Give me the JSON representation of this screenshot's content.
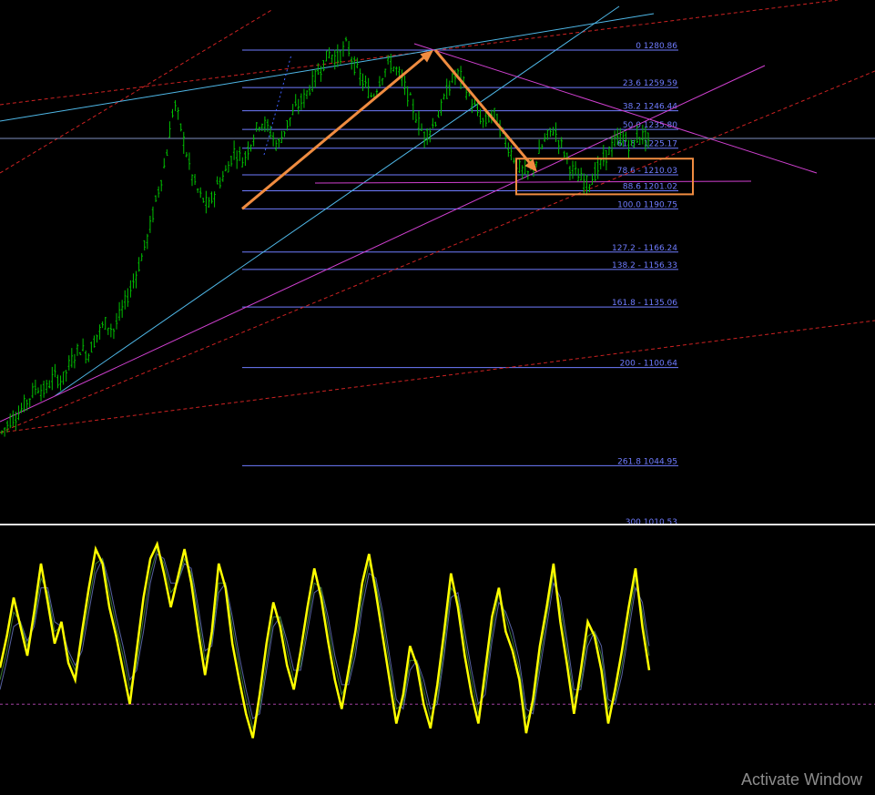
{
  "chart_data": [
    {
      "type": "candlestick",
      "pane": "price",
      "ylim": [
        1000,
        1320
      ],
      "colors": {
        "up": "#00c000",
        "down": "#00c000",
        "background": "#000000"
      },
      "fib_levels": [
        {
          "ratio": "0",
          "price": 1280.86,
          "label": "0 1280.86"
        },
        {
          "ratio": "23.6",
          "price": 1259.59,
          "label": "23.6 1259.59"
        },
        {
          "ratio": "38.2",
          "price": 1246.44,
          "label": "38.2 1246.44"
        },
        {
          "ratio": "50.0",
          "price": 1235.8,
          "label": "50.0 1235.80"
        },
        {
          "ratio": "61.8",
          "price": 1225.17,
          "label": "61.8 - 1225.17"
        },
        {
          "ratio": "78.6",
          "price": 1210.03,
          "label": "78.6 - 1210.03"
        },
        {
          "ratio": "88.6",
          "price": 1201.02,
          "label": "88.6 1201.02"
        },
        {
          "ratio": "100.0",
          "price": 1190.75,
          "label": "100.0 1190.75"
        },
        {
          "ratio": "127.2",
          "price": 1166.24,
          "label": "127.2 - 1166.24"
        },
        {
          "ratio": "138.2",
          "price": 1156.33,
          "label": "138.2 - 1156.33"
        },
        {
          "ratio": "161.8",
          "price": 1135.06,
          "label": "161.8 - 1135.06"
        },
        {
          "ratio": "200",
          "price": 1100.64,
          "label": "200 - 1100.64"
        },
        {
          "ratio": "261.8",
          "price": 1044.95,
          "label": "261.8 1044.95"
        },
        {
          "ratio": "300",
          "price": 1010.53,
          "label": "300 1010.53"
        }
      ],
      "fib_color": "#6f7cff",
      "price_trend": [
        1064,
        1071,
        1075,
        1082,
        1090,
        1087,
        1096,
        1093,
        1104,
        1112,
        1108,
        1119,
        1126,
        1122,
        1134,
        1146,
        1160,
        1176,
        1198,
        1218,
        1252,
        1232,
        1210,
        1198,
        1192,
        1204,
        1212,
        1224,
        1218,
        1230,
        1241,
        1236,
        1226,
        1238,
        1247,
        1253,
        1262,
        1271,
        1279,
        1276,
        1284,
        1271,
        1262,
        1254,
        1266,
        1274,
        1268,
        1257,
        1244,
        1232,
        1238,
        1248,
        1262,
        1268,
        1257,
        1247,
        1239,
        1246,
        1234,
        1224,
        1214,
        1210,
        1218,
        1230,
        1236,
        1226,
        1214,
        1208,
        1205,
        1212,
        1220,
        1228,
        1232,
        1226,
        1233,
        1230
      ],
      "annotations": {
        "arrow_up": {
          "from_price": 1190.75,
          "to_price": 1280.86,
          "color": "#f08c40"
        },
        "arrow_down": {
          "from_price": 1280.86,
          "to_price": 1210.03,
          "color": "#f08c40"
        },
        "box": {
          "price_high": 1212,
          "price_low": 1199,
          "color": "#f08c40"
        }
      }
    },
    {
      "type": "line",
      "pane": "oscillator",
      "ylim": [
        0,
        100
      ],
      "series": [
        {
          "color": "#ffff00",
          "values": [
            45,
            58,
            74,
            62,
            50,
            68,
            88,
            72,
            55,
            64,
            47,
            40,
            60,
            78,
            94,
            88,
            70,
            58,
            44,
            30,
            52,
            74,
            90,
            96,
            84,
            70,
            82,
            94,
            80,
            60,
            42,
            60,
            88,
            78,
            55,
            40,
            26,
            16,
            34,
            55,
            72,
            62,
            46,
            36,
            52,
            70,
            86,
            74,
            56,
            40,
            28,
            44,
            60,
            80,
            92,
            76,
            58,
            40,
            22,
            34,
            54,
            46,
            30,
            20,
            38,
            60,
            84,
            70,
            50,
            34,
            22,
            44,
            66,
            78,
            60,
            52,
            40,
            18,
            32,
            54,
            70,
            88,
            64,
            46,
            26,
            44,
            64,
            58,
            44,
            22,
            36,
            52,
            70,
            86,
            62,
            44
          ]
        },
        {
          "color": "#3d7a2e",
          "values": [
            40,
            52,
            68,
            64,
            54,
            64,
            82,
            76,
            60,
            62,
            50,
            44,
            56,
            72,
            88,
            90,
            76,
            62,
            50,
            36,
            46,
            66,
            84,
            94,
            88,
            76,
            80,
            90,
            84,
            66,
            48,
            56,
            80,
            80,
            62,
            46,
            32,
            20,
            28,
            48,
            66,
            66,
            52,
            40,
            46,
            64,
            80,
            78,
            62,
            46,
            34,
            40,
            54,
            74,
            88,
            80,
            64,
            46,
            28,
            30,
            48,
            48,
            36,
            24,
            32,
            54,
            78,
            74,
            56,
            40,
            26,
            38,
            60,
            76,
            66,
            56,
            44,
            24,
            28,
            48,
            66,
            84,
            70,
            52,
            32,
            38,
            58,
            60,
            50,
            28,
            32,
            46,
            64,
            82,
            68,
            50
          ]
        },
        {
          "color": "#5560a0",
          "values": [
            36,
            48,
            62,
            64,
            56,
            62,
            78,
            78,
            64,
            62,
            52,
            46,
            52,
            68,
            84,
            90,
            80,
            66,
            54,
            40,
            44,
            60,
            80,
            92,
            90,
            80,
            80,
            88,
            86,
            70,
            52,
            54,
            76,
            80,
            66,
            50,
            36,
            24,
            26,
            44,
            62,
            66,
            56,
            44,
            44,
            60,
            76,
            78,
            66,
            50,
            38,
            38,
            50,
            70,
            84,
            82,
            68,
            50,
            32,
            28,
            44,
            48,
            40,
            28,
            30,
            50,
            74,
            76,
            60,
            44,
            30,
            34,
            56,
            72,
            68,
            60,
            48,
            28,
            26,
            44,
            62,
            80,
            74,
            56,
            36,
            36,
            54,
            60,
            54,
            32,
            30,
            42,
            60,
            78,
            72,
            54
          ]
        }
      ],
      "reference_line": {
        "value": 30,
        "color": "#a040a0"
      }
    }
  ],
  "watermark": "Activate Window"
}
